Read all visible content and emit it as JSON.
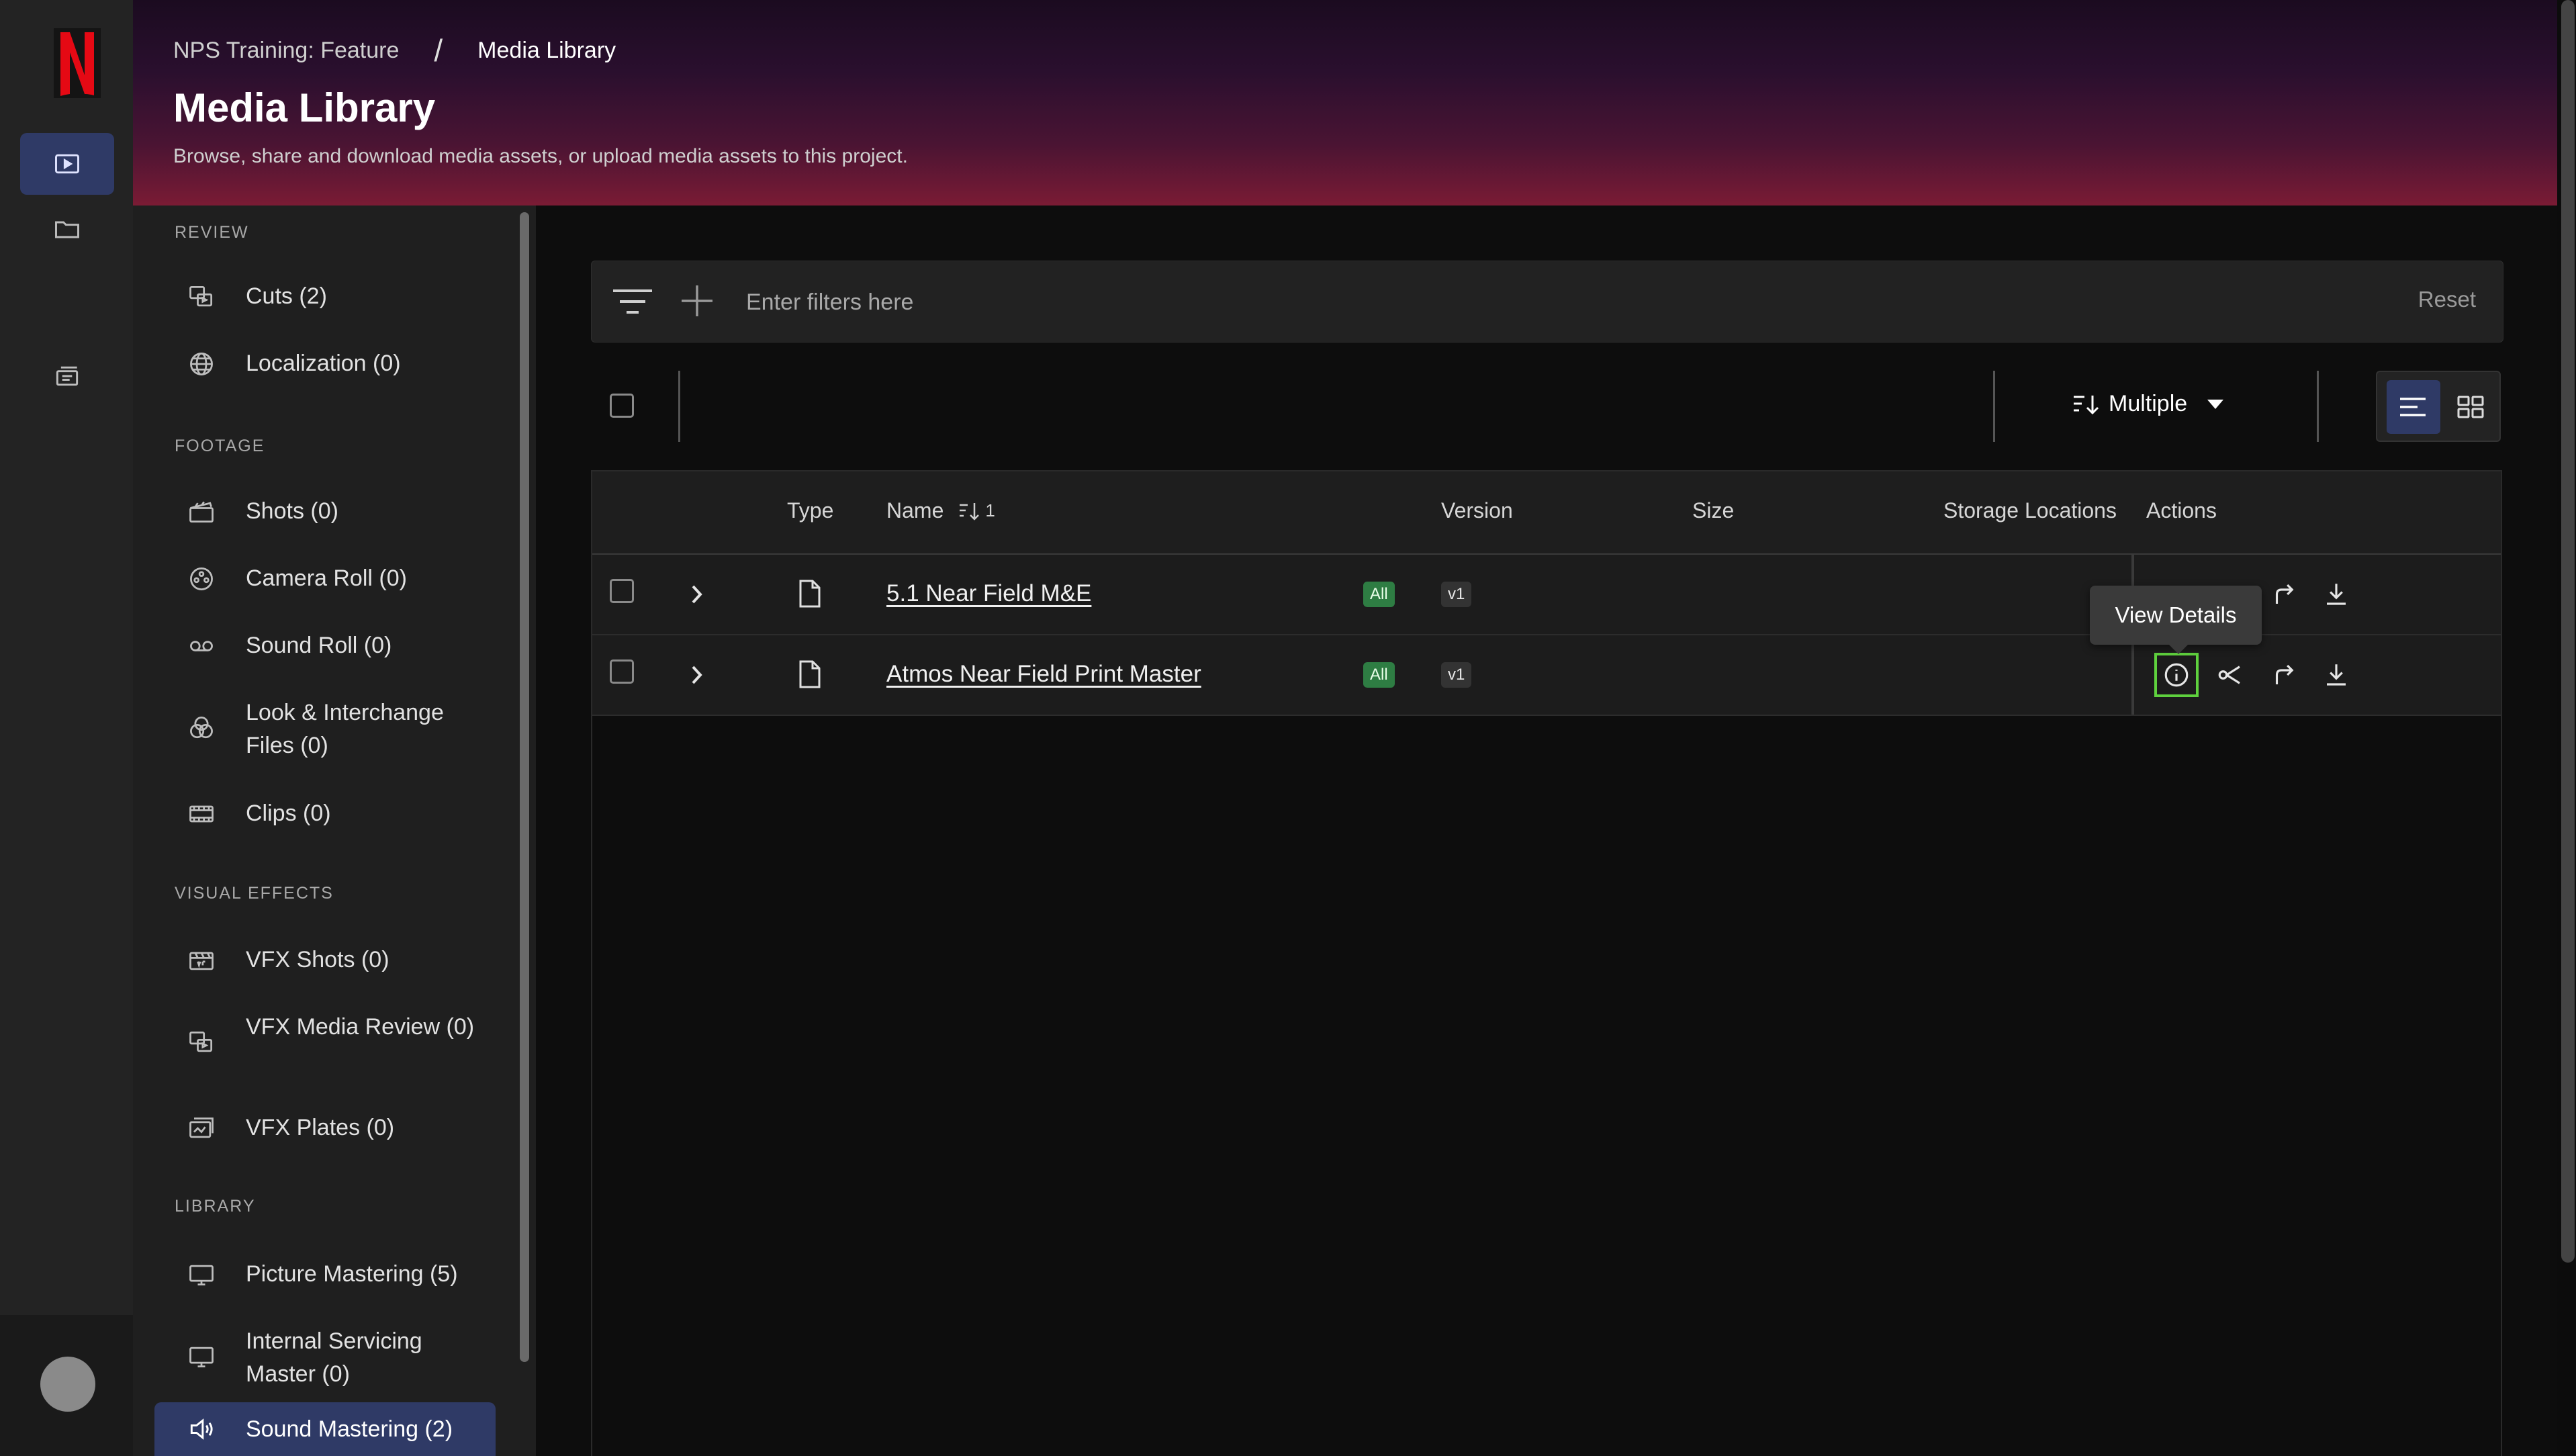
{
  "header": {
    "breadcrumb": [
      "NPS Training: Feature",
      "/",
      "Media Library"
    ],
    "title": "Media Library",
    "subtitle": "Browse, share and download media assets, or upload media assets to this project."
  },
  "rail": {
    "logo": "N",
    "items": [
      "media-library-icon",
      "folder-icon",
      "transfers-icon"
    ]
  },
  "sidebar": {
    "sections": [
      {
        "label": "REVIEW",
        "items": [
          {
            "label": "Cuts (2)",
            "icon": "cuts-icon"
          },
          {
            "label": "Localization (0)",
            "icon": "globe-icon"
          }
        ]
      },
      {
        "label": "FOOTAGE",
        "items": [
          {
            "label": "Shots (0)",
            "icon": "clapper-icon"
          },
          {
            "label": "Camera Roll (0)",
            "icon": "film-reel-icon"
          },
          {
            "label": "Sound Roll (0)",
            "icon": "tape-icon"
          },
          {
            "label": "Look & Interchange Files (0)",
            "icon": "color-circles-icon"
          },
          {
            "label": "Clips (0)",
            "icon": "film-strip-icon"
          }
        ]
      },
      {
        "label": "VISUAL EFFECTS",
        "items": [
          {
            "label": "VFX Shots (0)",
            "icon": "vfx-clapper-icon"
          },
          {
            "label": "VFX Media Review (0)",
            "icon": "vfx-review-icon"
          },
          {
            "label": "VFX Plates (0)",
            "icon": "plates-icon"
          }
        ]
      },
      {
        "label": "LIBRARY",
        "items": [
          {
            "label": "Picture Mastering (5)",
            "icon": "monitor-icon"
          },
          {
            "label": "Internal Servicing Master (0)",
            "icon": "monitor-icon"
          },
          {
            "label": "Sound Mastering (2)",
            "icon": "speaker-icon",
            "active": true
          }
        ]
      }
    ]
  },
  "filters": {
    "placeholder": "Enter filters here",
    "reset_label": "Reset"
  },
  "toolbar": {
    "sort_label": "Multiple"
  },
  "table": {
    "columns": [
      "Type",
      "Name",
      "Version",
      "Size",
      "Storage Locations",
      "Actions"
    ],
    "name_sort_index": "1",
    "rows": [
      {
        "name": "5.1 Near Field M&E",
        "badge": "All",
        "version": "v1",
        "size": "",
        "storage": ""
      },
      {
        "name": "Atmos Near Field Print Master",
        "badge": "All",
        "version": "v1",
        "size": "",
        "storage": ""
      }
    ]
  },
  "tooltip": "View Details",
  "colors": {
    "accent": "#2f3a66",
    "badge_green": "#2e7d43",
    "focus_ring": "#5fd13e",
    "logo_red": "#e50914"
  }
}
